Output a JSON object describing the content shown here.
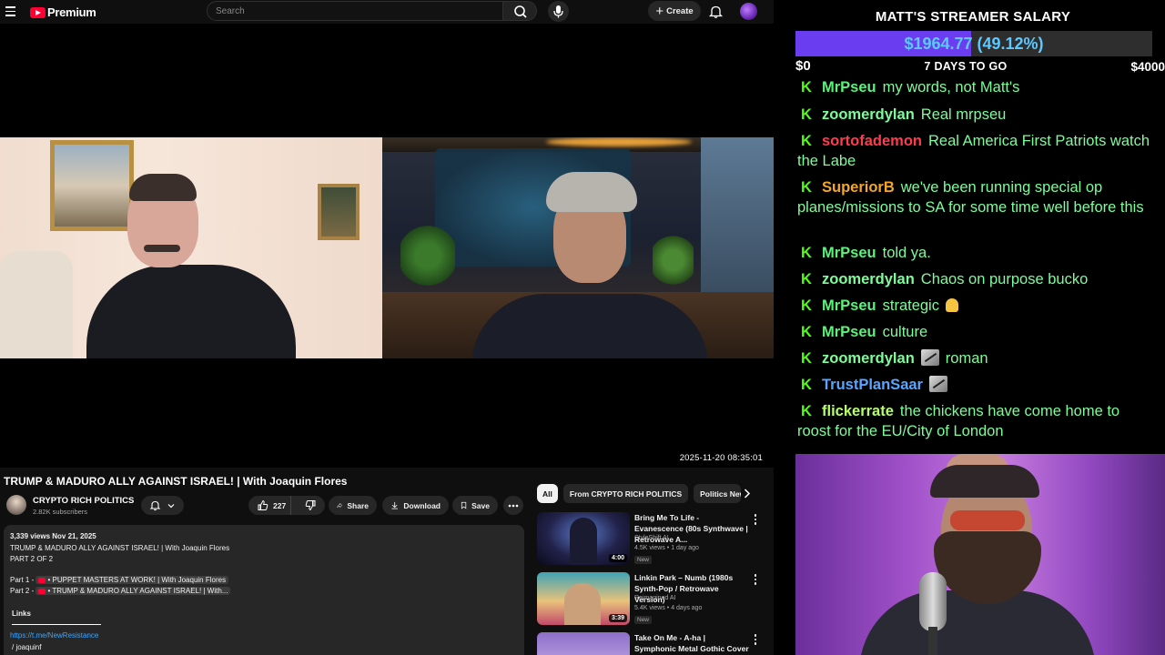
{
  "youtube": {
    "brand": "Premium",
    "search_placeholder": "Search",
    "create_label": "Create",
    "player": {
      "timestamp": "2025-11-20 08:35:01"
    },
    "video": {
      "title": "TRUMP & MADURO ALLY AGAINST ISRAEL! | With Joaquin Flores",
      "channel_name": "CRYPTO RICH POLITICS",
      "subscribers": "2.82K subscribers",
      "like_count": "227",
      "share_label": "Share",
      "download_label": "Download",
      "save_label": "Save"
    },
    "description": {
      "meta": "3,339 views  Nov 21, 2025",
      "line1": "TRUMP & MADURO ALLY AGAINST ISRAEL! | With Joaquin Flores",
      "line2": "PART 2 OF 2",
      "part1_prefix": "Part 1 -",
      "part1_link": "• PUPPET MASTERS AT WORK! | With Joaquin Flores",
      "part2_prefix": "Part 2 -",
      "part2_link": "• TRUMP & MADURO ALLY AGAINST ISRAEL! | With...",
      "links_label": "Links",
      "link1": "https://t.me/NewResistance",
      "link2": "/ joaquinf"
    },
    "chips": [
      "All",
      "From CRYPTO RICH POLITICS",
      "Politics News"
    ],
    "recommendations": [
      {
        "title": "Bring Me To Life - Evanescence (80s Synthwave | Retrowave A...",
        "channel": "StyleShift AI",
        "views": "4.5K views • 1 day ago",
        "badge": "New",
        "duration": "4:00"
      },
      {
        "title": "Linkin Park – Numb (1980s Synth-Pop / Retrowave Version)",
        "channel": "Reimagined AI",
        "views": "5.4K views • 4 days ago",
        "badge": "New",
        "duration": "3:39"
      },
      {
        "title": "Take On Me - A-ha | Symphonic Metal Gothic Cover",
        "channel": "",
        "views": "",
        "badge": "",
        "duration": ""
      }
    ]
  },
  "overlay": {
    "title": "MATT'S STREAMER SALARY",
    "progress_text": "$1964.77 (49.12%)",
    "progress_fraction": 0.4912,
    "range_low": "$0",
    "countdown": "7 DAYS TO GO",
    "range_high": "$4000",
    "colors": {
      "bar_fill": "#6a3df0",
      "bar_text": "#5ec8ff",
      "chat_text": "#7dfc9a",
      "kick_icon": "#53fc18"
    },
    "chat": [
      {
        "user": "MrPseu",
        "color": "#5cf27a",
        "text": "my words, not Matt's"
      },
      {
        "user": "zoomerdylan",
        "color": "#7dfc9a",
        "text": "Real mrpseu"
      },
      {
        "user": "sortofademon",
        "color": "#ff3b4f",
        "text": "Real America First Patriots watch the Labe"
      },
      {
        "user": "SuperiorB",
        "color": "#f5a623",
        "text": "we've been running special op planes/missions to SA for some time well before this"
      },
      {
        "user": "MrPseu",
        "color": "#5cf27a",
        "text": "told ya."
      },
      {
        "user": "zoomerdylan",
        "color": "#7dfc9a",
        "text": "Chaos on purpose bucko"
      },
      {
        "user": "MrPseu",
        "color": "#5cf27a",
        "text": "strategic",
        "emote": "bell"
      },
      {
        "user": "MrPseu",
        "color": "#5cf27a",
        "text": "culture"
      },
      {
        "user": "zoomerdylan",
        "color": "#7dfc9a",
        "text": "roman",
        "emote_before": "salute"
      },
      {
        "user": "TrustPlanSaar",
        "color": "#58a6ff",
        "text": "",
        "emote_before": "salute"
      },
      {
        "user": "flickerrate",
        "color": "#b8ff6a",
        "text": "the chickens have come home to roost for the EU/City of London"
      }
    ]
  }
}
